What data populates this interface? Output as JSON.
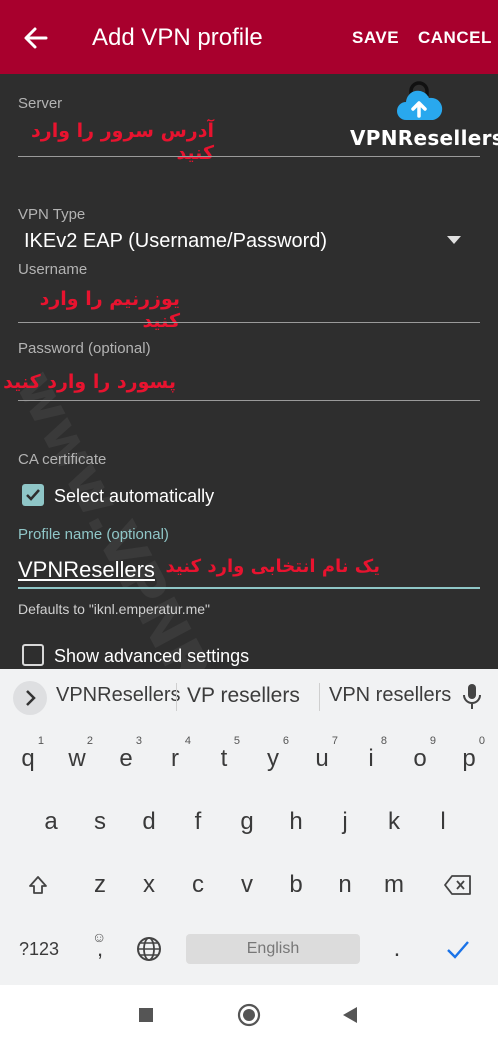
{
  "app_bar": {
    "title": "Add VPN profile",
    "save_label": "SAVE",
    "cancel_label": "CANCEL",
    "back_icon": "arrow-left-icon"
  },
  "branding": {
    "logo_text": "VPNResellers",
    "watermark_text": "www.VPNResellers.me",
    "cloud_icon": "cloud-upload-lock-icon"
  },
  "form": {
    "server": {
      "label": "Server",
      "hint": "آدرس سرور را وارد کنید"
    },
    "vpn_type": {
      "label": "VPN Type",
      "value": "IKEv2 EAP (Username/Password)"
    },
    "username": {
      "label": "Username",
      "hint": "یوزرنیم را وارد کنید"
    },
    "password": {
      "label": "Password (optional)",
      "hint": "پسورد را وارد کنید"
    },
    "ca_certificate": {
      "label": "CA certificate",
      "checkbox_label": "Select automatically",
      "checked": true
    },
    "profile_name": {
      "label": "Profile name (optional)",
      "value": "VPNResellers",
      "hint": "یک نام انتخابی وارد کنید",
      "helper": "Defaults to \"iknl.emperatur.me\""
    },
    "advanced": {
      "checkbox_label": "Show advanced settings",
      "checked": false
    }
  },
  "keyboard": {
    "suggestions": [
      "VPNResellers",
      "VP resellers",
      "VPN resellers"
    ],
    "row1": [
      {
        "key": "q",
        "sup": "1"
      },
      {
        "key": "w",
        "sup": "2"
      },
      {
        "key": "e",
        "sup": "3"
      },
      {
        "key": "r",
        "sup": "4"
      },
      {
        "key": "t",
        "sup": "5"
      },
      {
        "key": "y",
        "sup": "6"
      },
      {
        "key": "u",
        "sup": "7"
      },
      {
        "key": "i",
        "sup": "8"
      },
      {
        "key": "o",
        "sup": "9"
      },
      {
        "key": "p",
        "sup": "0"
      }
    ],
    "row2": [
      "a",
      "s",
      "d",
      "f",
      "g",
      "h",
      "j",
      "k",
      "l"
    ],
    "row3": [
      "z",
      "x",
      "c",
      "v",
      "b",
      "n",
      "m"
    ],
    "symbols_key": "?123",
    "emoji_sup": "☺",
    "comma_key": ",",
    "space_label": "English",
    "period_key": "."
  },
  "colors": {
    "app_bar": "#a8002d",
    "background": "#2e2e2e",
    "accent": "#8fc6c7",
    "hint_red": "#e8132f",
    "keyboard_bg": "#f1f2f3",
    "check_blue": "#1a73e8"
  }
}
